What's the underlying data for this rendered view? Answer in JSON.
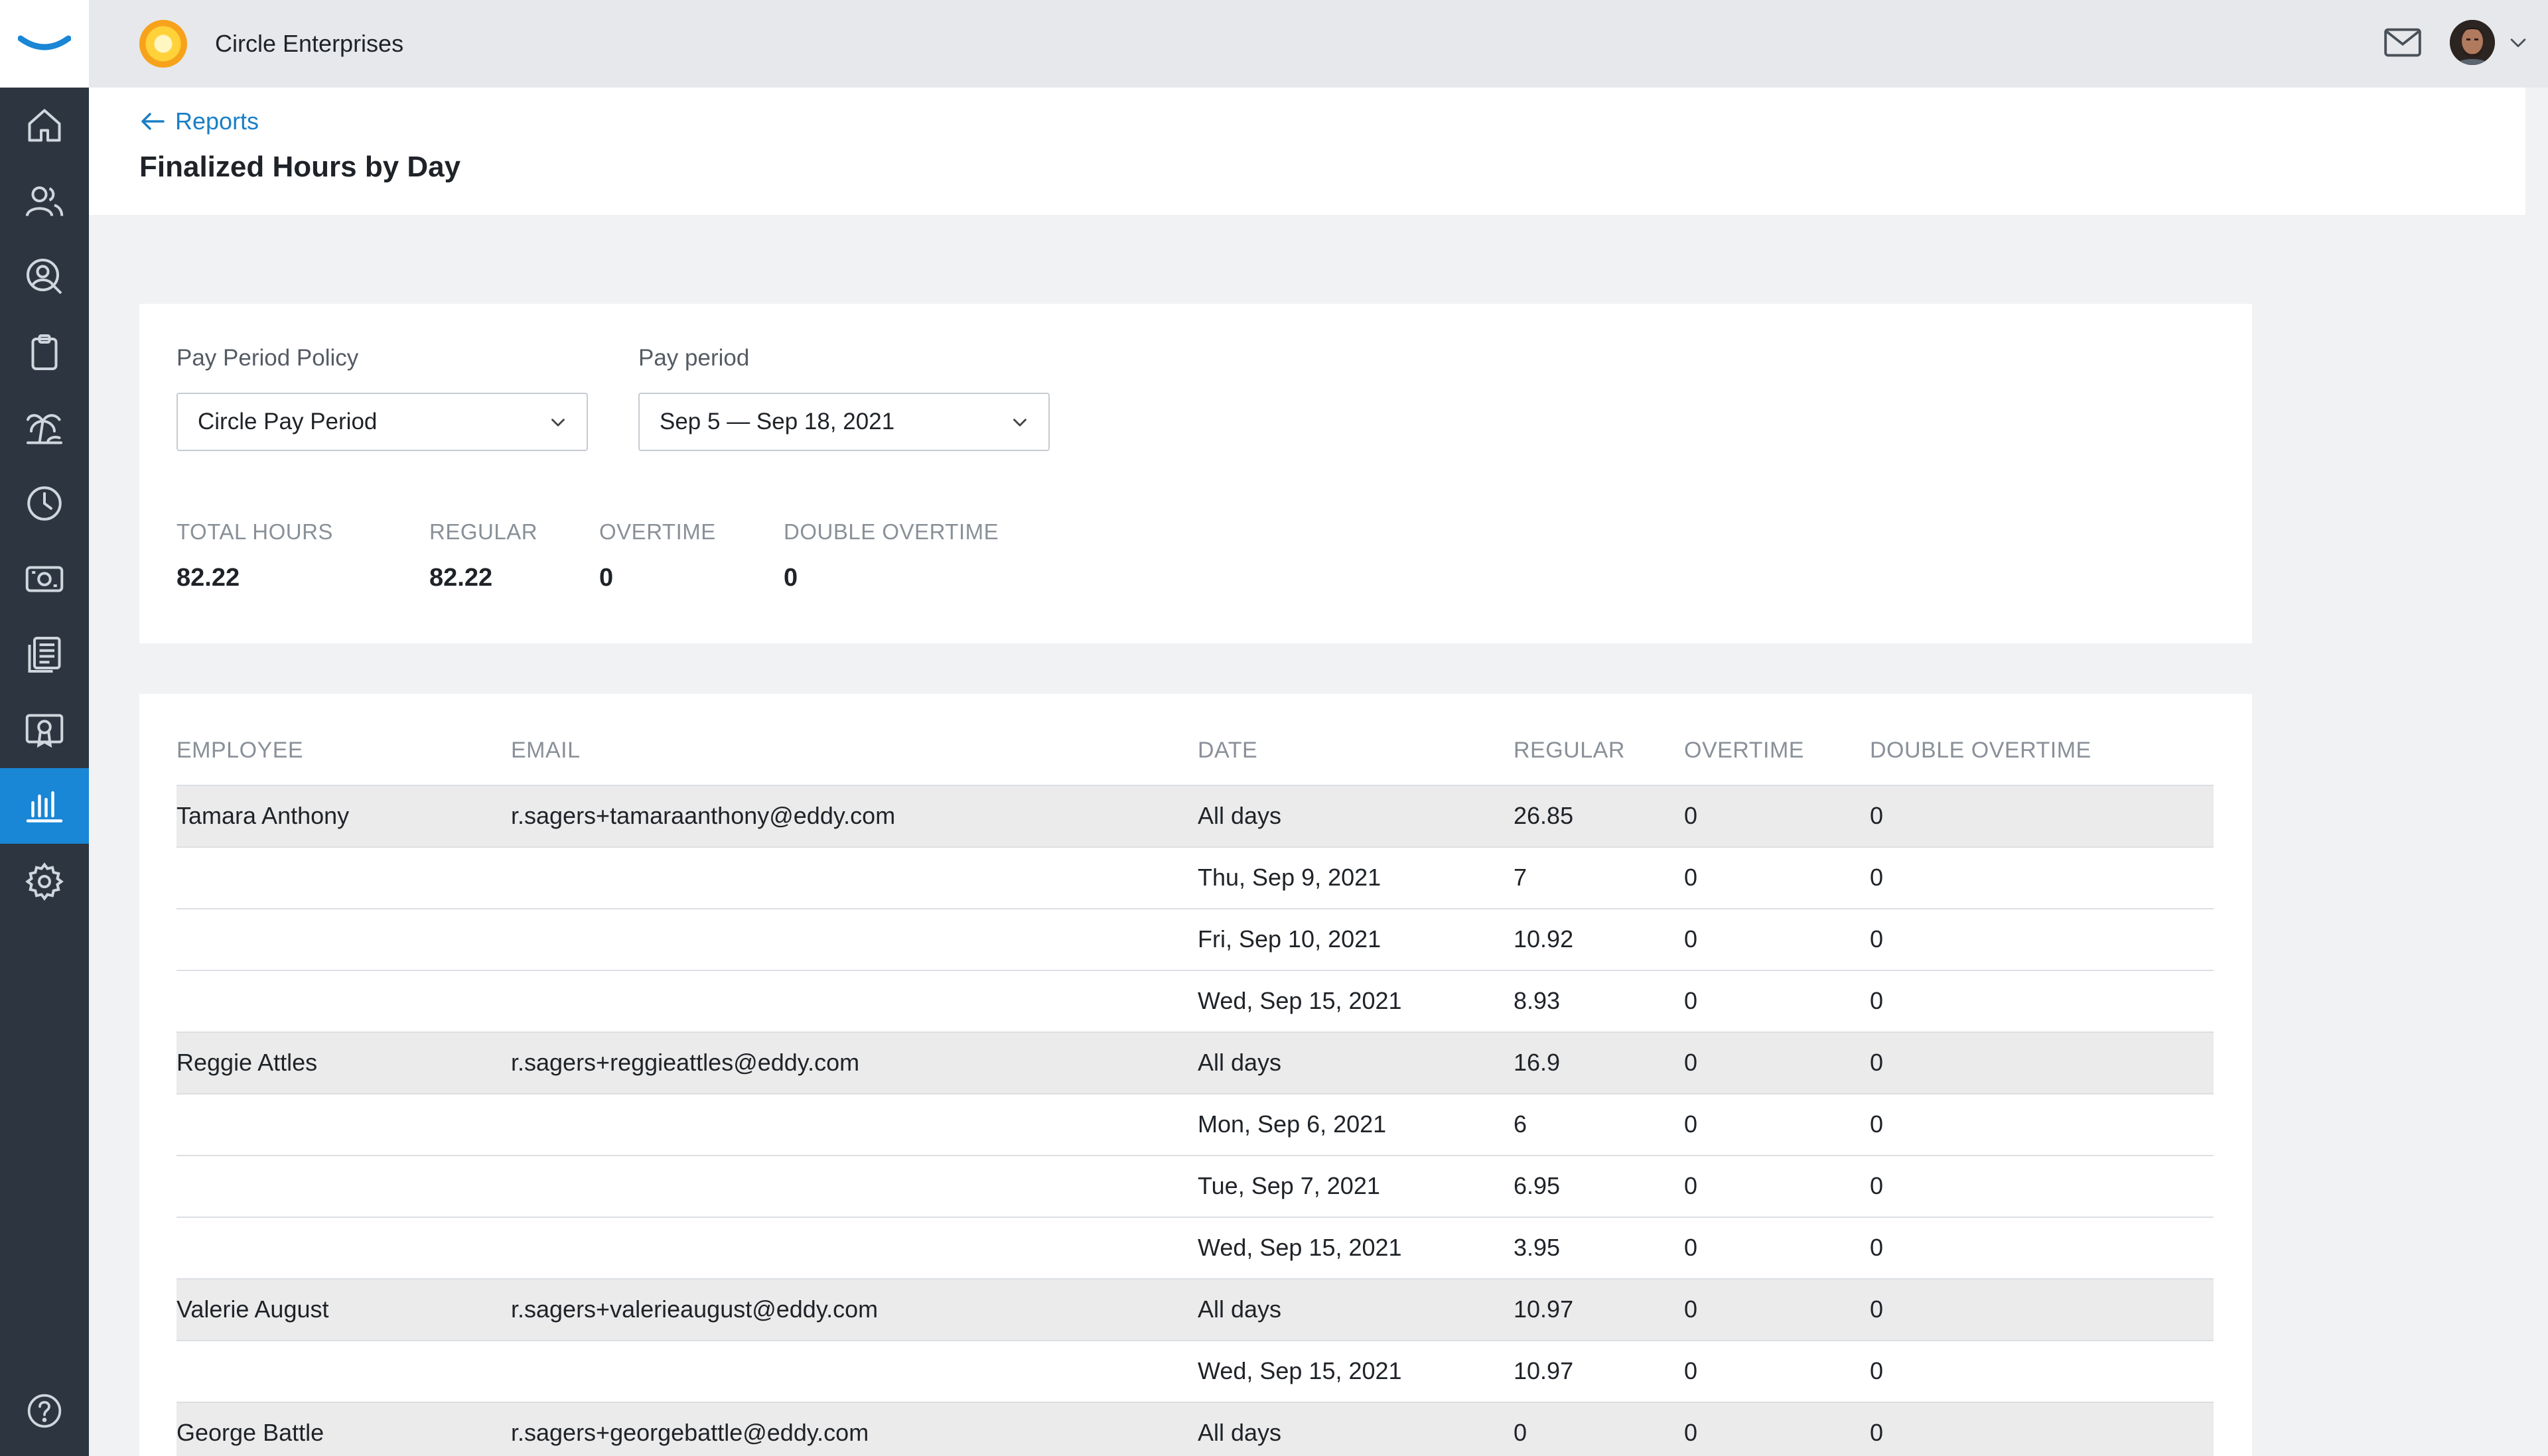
{
  "topbar": {
    "company_name": "Circle Enterprises",
    "icons": [
      "mail-icon",
      "avatar",
      "chevron-down-icon"
    ]
  },
  "sidebar": {
    "items": [
      {
        "name": "home",
        "icon": "home-icon"
      },
      {
        "name": "people",
        "icon": "people-icon"
      },
      {
        "name": "hiring",
        "icon": "user-search-icon"
      },
      {
        "name": "tasks",
        "icon": "clipboard-icon"
      },
      {
        "name": "time-off",
        "icon": "palm-tree-icon"
      },
      {
        "name": "time",
        "icon": "clock-icon"
      },
      {
        "name": "payroll",
        "icon": "money-icon"
      },
      {
        "name": "documents",
        "icon": "documents-icon"
      },
      {
        "name": "certifications",
        "icon": "certificate-icon"
      },
      {
        "name": "reports",
        "icon": "bar-chart-icon",
        "active": true
      },
      {
        "name": "settings",
        "icon": "gear-icon"
      }
    ],
    "help_icon": "help-icon",
    "active_color": "#1a86d6"
  },
  "header": {
    "back_label": "Reports",
    "title": "Finalized Hours by Day"
  },
  "filters": {
    "policy_label": "Pay Period Policy",
    "policy_value": "Circle Pay Period",
    "period_label": "Pay period",
    "period_value": "Sep 5 — Sep 18, 2021"
  },
  "stats": {
    "total_label": "TOTAL HOURS",
    "total_value": "82.22",
    "regular_label": "REGULAR",
    "regular_value": "82.22",
    "overtime_label": "OVERTIME",
    "overtime_value": "0",
    "double_label": "DOUBLE OVERTIME",
    "double_value": "0"
  },
  "table": {
    "headers": {
      "employee": "EMPLOYEE",
      "email": "EMAIL",
      "date": "DATE",
      "regular": "REGULAR",
      "overtime": "OVERTIME",
      "double": "DOUBLE OVERTIME"
    },
    "rows": [
      {
        "employee": "Tamara Anthony",
        "email": "r.sagers+tamaraanthony@eddy.com",
        "date": "All days",
        "regular": "26.85",
        "overtime": "0",
        "double": "0"
      },
      {
        "employee": "",
        "email": "",
        "date": "Thu, Sep 9, 2021",
        "regular": "7",
        "overtime": "0",
        "double": "0"
      },
      {
        "employee": "",
        "email": "",
        "date": "Fri, Sep 10, 2021",
        "regular": "10.92",
        "overtime": "0",
        "double": "0"
      },
      {
        "employee": "",
        "email": "",
        "date": "Wed, Sep 15, 2021",
        "regular": "8.93",
        "overtime": "0",
        "double": "0"
      },
      {
        "employee": "Reggie Attles",
        "email": "r.sagers+reggieattles@eddy.com",
        "date": "All days",
        "regular": "16.9",
        "overtime": "0",
        "double": "0"
      },
      {
        "employee": "",
        "email": "",
        "date": "Mon, Sep 6, 2021",
        "regular": "6",
        "overtime": "0",
        "double": "0"
      },
      {
        "employee": "",
        "email": "",
        "date": "Tue, Sep 7, 2021",
        "regular": "6.95",
        "overtime": "0",
        "double": "0"
      },
      {
        "employee": "",
        "email": "",
        "date": "Wed, Sep 15, 2021",
        "regular": "3.95",
        "overtime": "0",
        "double": "0"
      },
      {
        "employee": "Valerie August",
        "email": "r.sagers+valerieaugust@eddy.com",
        "date": "All days",
        "regular": "10.97",
        "overtime": "0",
        "double": "0"
      },
      {
        "employee": "",
        "email": "",
        "date": "Wed, Sep 15, 2021",
        "regular": "10.97",
        "overtime": "0",
        "double": "0"
      },
      {
        "employee": "George Battle",
        "email": "r.sagers+georgebattle@eddy.com",
        "date": "All days",
        "regular": "0",
        "overtime": "0",
        "double": "0"
      }
    ]
  }
}
